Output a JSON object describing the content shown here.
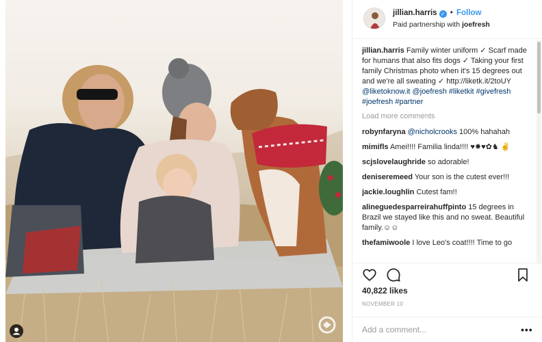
{
  "post": {
    "author": {
      "username": "jillian.harris",
      "verified": true,
      "follow_label": "Follow",
      "partnership_prefix": "Paid partnership with ",
      "partner": "joefresh"
    },
    "caption": {
      "username": "jillian.harris",
      "parts": [
        {
          "text": " Family winter uniform ✓ Scarf made for humans that also fits dogs ✓ Taking your first family Christmas photo when it's 15 degrees out and we're all sweating ✓ ",
          "link": false
        },
        {
          "text": "http://liketk.it/2toUY",
          "link": false
        },
        {
          "text": " ",
          "link": false
        },
        {
          "text": "@liketoknow.it",
          "link": true
        },
        {
          "text": " ",
          "link": false
        },
        {
          "text": "@joefresh",
          "link": true
        },
        {
          "text": " ",
          "link": false
        },
        {
          "text": "#liketkit",
          "link": true
        },
        {
          "text": " ",
          "link": false
        },
        {
          "text": "#givefresh",
          "link": true
        },
        {
          "text": " ",
          "link": false
        },
        {
          "text": "#joefresh",
          "link": true
        },
        {
          "text": " ",
          "link": false
        },
        {
          "text": "#partner",
          "link": true
        }
      ]
    },
    "load_more_label": "Load more comments",
    "comments": [
      {
        "user": "robynfaryna",
        "mention": "@nicholcrooks",
        "text": " 100% hahahah"
      },
      {
        "user": "mimifls",
        "mention": "",
        "text": " Amei!!!! Familia linda!!!! ♥✸♥✿♞ ✌"
      },
      {
        "user": "scjslovelaughride",
        "mention": "",
        "text": " so adorable!"
      },
      {
        "user": "deniseremeed",
        "mention": "",
        "text": " Your son is the cutest ever!!!"
      },
      {
        "user": "jackie.loughlin",
        "mention": "",
        "text": " Cutest fam!!"
      },
      {
        "user": "alineguedesparreirahuffpinto",
        "mention": "",
        "text": " 15 degrees in Brazil we stayed like this and no sweat. Beautiful family.☺☺"
      },
      {
        "user": "thefamiwoole",
        "mention": "",
        "text": " I love Leo's coat!!!! Time to go"
      }
    ],
    "likes": "40,822 likes",
    "date": "NOVEMBER 10",
    "add_comment_placeholder": "Add a comment...",
    "more_label": "•••",
    "icons": {
      "like": "heart-icon",
      "comment": "comment-icon",
      "save": "bookmark-icon",
      "verified": "verified-badge-icon",
      "user_tags": "user-tag-icon",
      "watermark": "liketoknowit-logo-icon"
    },
    "colors": {
      "link": "#003569",
      "follow": "#3897f0",
      "muted": "#999999",
      "text": "#262626",
      "border": "#efefef"
    }
  }
}
